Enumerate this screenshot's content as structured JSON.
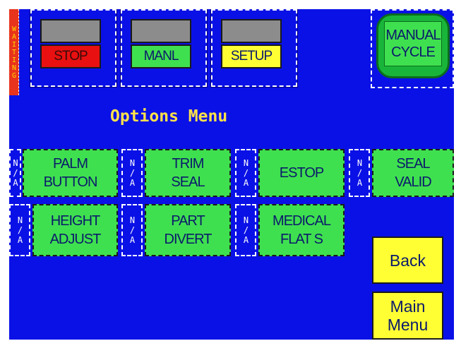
{
  "status_strip": {
    "label": "WAITING",
    "color": "#e8341c"
  },
  "status_buttons": [
    {
      "label": "STOP",
      "color": "#e81010"
    },
    {
      "label": "MANL",
      "color": "#3fe04f"
    },
    {
      "label": "SETUP",
      "color": "#ffff33"
    }
  ],
  "manual_cycle": {
    "line1": "MANUAL",
    "line2": "CYCLE"
  },
  "title": "Options Menu",
  "na_label": "N/A",
  "options": [
    {
      "line1": "PALM",
      "line2": "BUTTON"
    },
    {
      "line1": "TRIM",
      "line2": "SEAL"
    },
    {
      "line1": "ESTOP",
      "line2": ""
    },
    {
      "line1": "SEAL",
      "line2": "VALID"
    },
    {
      "line1": "HEIGHT",
      "line2": "ADJUST"
    },
    {
      "line1": "PART",
      "line2": "DIVERT"
    },
    {
      "line1": "MEDICAL",
      "line2": "FLAT S"
    }
  ],
  "back_button": {
    "label": "Back"
  },
  "main_menu_button": {
    "line1": "Main",
    "line2": "Menu"
  },
  "colors": {
    "background": "#0a11e6",
    "accent_green": "#3fe04f",
    "accent_yellow": "#ffff33",
    "title": "#ffe24a"
  }
}
